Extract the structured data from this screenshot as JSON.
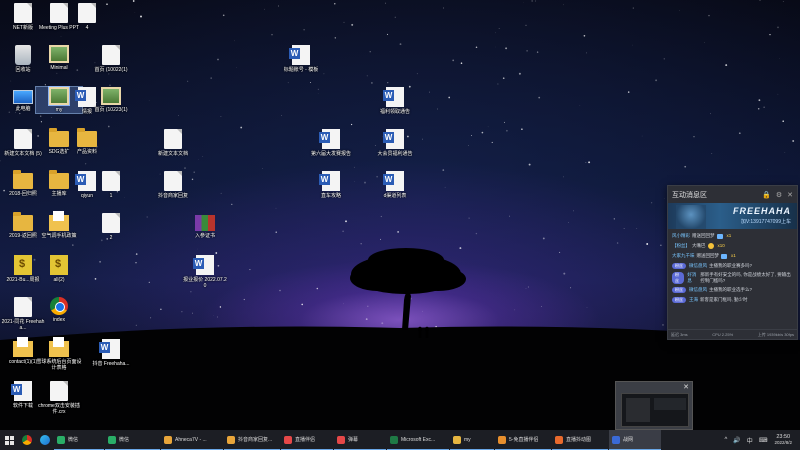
{
  "desktop_icons": [
    {
      "name": "icon-net",
      "label": "NET新版",
      "type": "file"
    },
    {
      "name": "icon-meeting-plus",
      "label": "Meeting Plus PPT",
      "type": "file"
    },
    {
      "name": "icon-4",
      "label": "4",
      "type": "file"
    },
    {
      "name": "icon-recycle",
      "label": "回收站",
      "type": "recycle"
    },
    {
      "name": "icon-minimal",
      "label": "Minimal",
      "type": "img"
    },
    {
      "name": "icon-first-page-1",
      "label": "首页 (10022(1)",
      "type": "file"
    },
    {
      "name": "icon-title-template",
      "label": "标题账号 - 模板",
      "type": "word"
    },
    {
      "name": "icon-this-pc",
      "label": "此电脑",
      "type": "pc"
    },
    {
      "name": "icon-my",
      "label": "my",
      "type": "img"
    },
    {
      "name": "icon-qingbao",
      "label": "情报",
      "type": "word"
    },
    {
      "name": "icon-first-page-2",
      "label": "首页 (10223(1)",
      "type": "img"
    },
    {
      "name": "icon-welfare-notice",
      "label": "福利领取通告",
      "type": "word"
    },
    {
      "name": "icon-new-text-5",
      "label": "新建文本文档 (5)",
      "type": "file"
    },
    {
      "name": "icon-sdg",
      "label": "SDG选扩",
      "type": "folder"
    },
    {
      "name": "icon-product",
      "label": "产品资料",
      "type": "folder"
    },
    {
      "name": "icon-new-text",
      "label": "新建文本文档",
      "type": "file"
    },
    {
      "name": "icon-sixth-live",
      "label": "第六届大发赛报告",
      "type": "word"
    },
    {
      "name": "icon-big-collection",
      "label": "大会员福利通告",
      "type": "word"
    },
    {
      "name": "icon-2018",
      "label": "2018-回归照",
      "type": "folder"
    },
    {
      "name": "icon-anchor",
      "label": "主播库",
      "type": "folder"
    },
    {
      "name": "icon-qiyun",
      "label": "qiyun",
      "type": "word"
    },
    {
      "name": "icon-1",
      "label": "1",
      "type": "file"
    },
    {
      "name": "icon-douyin-reply",
      "label": "抖音商家回复",
      "type": "file"
    },
    {
      "name": "icon-live-rules",
      "label": "直车攻略",
      "type": "word"
    },
    {
      "name": "icon-d-channel",
      "label": "d渠道列表",
      "type": "word"
    },
    {
      "name": "icon-2019",
      "label": "2019-返回照",
      "type": "folder"
    },
    {
      "name": "icon-aircon",
      "label": "空气调手机政策",
      "type": "folder-doc"
    },
    {
      "name": "icon-2",
      "label": "2",
      "type": "file"
    },
    {
      "name": "icon-cert",
      "label": "入参证书",
      "type": "zip"
    },
    {
      "name": "icon-2021-bu",
      "label": "2021-Bu...周报",
      "type": "bank"
    },
    {
      "name": "icon-all2",
      "label": "all(2)",
      "type": "bank"
    },
    {
      "name": "icon-finance",
      "label": "报业报价 2022.07.20",
      "type": "word"
    },
    {
      "name": "icon-2021-free",
      "label": "2021-同花 Freehaha...",
      "type": "file"
    },
    {
      "name": "icon-index",
      "label": "index",
      "type": "chrome"
    },
    {
      "name": "icon-contact",
      "label": "contact(1)(1)",
      "type": "folder-doc"
    },
    {
      "name": "icon-ecology",
      "label": "雪球系统后台页面设计表格",
      "type": "folder-doc"
    },
    {
      "name": "icon-douyin-free",
      "label": "抖音 Freehaha...",
      "type": "word"
    },
    {
      "name": "icon-download",
      "label": "软件下载",
      "type": "word"
    },
    {
      "name": "icon-chrome-ext",
      "label": "chrome双击安装插件.crx",
      "type": "file"
    }
  ],
  "panel": {
    "title": "互动消息区",
    "controls": [
      "🔒",
      "⚙",
      "✕"
    ],
    "banner_title": "FREEHAHA",
    "banner_subtitle": "加V:13917747099上车",
    "messages": [
      {
        "badge": "",
        "user": "风小精彩",
        "action": "赠送回回梦",
        "suffix": "x1",
        "kind": "gift"
      },
      {
        "badge": "",
        "user": "【粉丝】",
        "action": "大嘴巴",
        "suffix": "x10",
        "kind": "emo"
      },
      {
        "badge": "",
        "user": "大家九千味",
        "action": "赠送回回梦",
        "suffix": "x1",
        "kind": "gift"
      },
      {
        "badge": "粉丝",
        "user": "微信盘风",
        "action": "主播我的职业赛多吗?",
        "suffix": "",
        "kind": "chat"
      },
      {
        "badge": "粉丝",
        "user": "好消息",
        "action": "那新手有好安全的吗, 你是战绩太好了, 要输出控制门槛吗?",
        "suffix": "",
        "kind": "chat"
      },
      {
        "badge": "粉丝",
        "user": "微信盘风",
        "action": "主播我的职业选手么?",
        "suffix": "",
        "kind": "chat"
      },
      {
        "badge": "粉丝",
        "user": "王海",
        "action": "新客是家门框吗, 勤少时",
        "suffix": "",
        "kind": "chat"
      }
    ],
    "footer_left": "延迟 3ms",
    "footer_mid": "CPU 2.25%",
    "footer_right": "上传 1939kb/s  30fps"
  },
  "thumbnail": {
    "close": "✕"
  },
  "taskbar": {
    "tasks": [
      {
        "name": "task-wechat-1",
        "label": "微信",
        "color": "#2aae67",
        "active": false
      },
      {
        "name": "task-wechat-2",
        "label": "微信",
        "color": "#2aae67",
        "active": false
      },
      {
        "name": "task-ahnexa",
        "label": "Ahneca7V - ...",
        "color": "#e8a53a",
        "active": false
      },
      {
        "name": "task-douyin-reply",
        "label": "抖音商家回复...",
        "color": "#e8a53a",
        "active": false
      },
      {
        "name": "task-live-helper",
        "label": "直播伴侣",
        "color": "#e54848",
        "active": false
      },
      {
        "name": "task-bullet",
        "label": "弹幕",
        "color": "#e54848",
        "active": false
      },
      {
        "name": "task-excel",
        "label": "Microsoft Exc...",
        "color": "#1f7a45",
        "active": false
      },
      {
        "name": "task-my",
        "label": "my",
        "color": "#e7b640",
        "active": false
      },
      {
        "name": "task-live-5",
        "label": "5-免直播伴侣",
        "color": "#e88f2d",
        "active": false
      },
      {
        "name": "task-chrome-live",
        "label": "直播抖动图",
        "color": "#e86a2d",
        "active": false
      },
      {
        "name": "task-live-room",
        "label": "战网",
        "color": "#3a6ad6",
        "active": true
      }
    ],
    "tray_icons": [
      "^",
      "🔊",
      "中",
      "⌨"
    ],
    "time": "23:50",
    "date": "2022/8/2"
  }
}
